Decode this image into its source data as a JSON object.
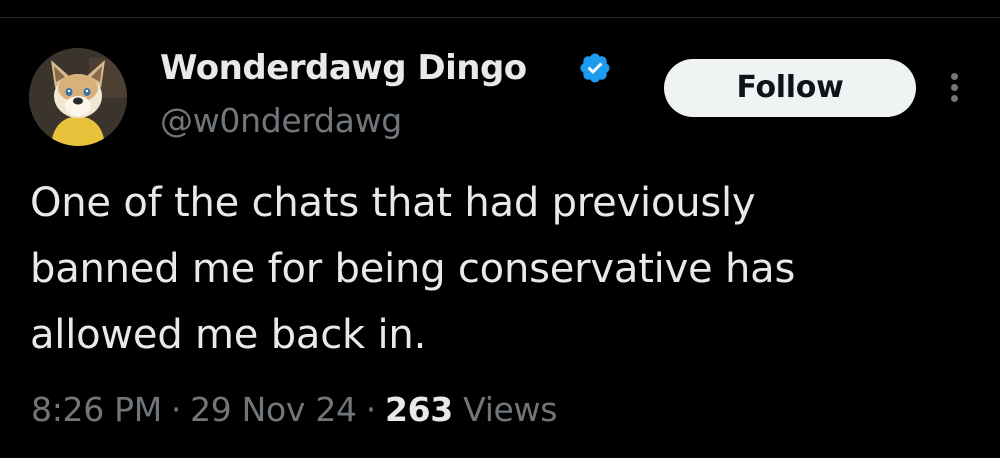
{
  "author": {
    "display_name": "Wonderdawg Dingo",
    "handle": "@w0nderdawg",
    "verified": true,
    "avatar_icon": "fursuit-dog-avatar"
  },
  "actions": {
    "follow_label": "Follow",
    "more_icon": "more-vertical-icon"
  },
  "tweet": {
    "text_lines": [
      "One of the chats that had previously",
      "banned me for being conservative has",
      "allowed me back in."
    ]
  },
  "meta": {
    "time": "8:26 PM",
    "separator": "·",
    "date": "29 Nov 24",
    "views_count": "263",
    "views_label": "Views"
  },
  "colors": {
    "background": "#000000",
    "primary_text": "#e7e9ea",
    "secondary_text": "#71767b",
    "verified_blue": "#1d9bf0",
    "follow_bg": "#eff3f4"
  }
}
